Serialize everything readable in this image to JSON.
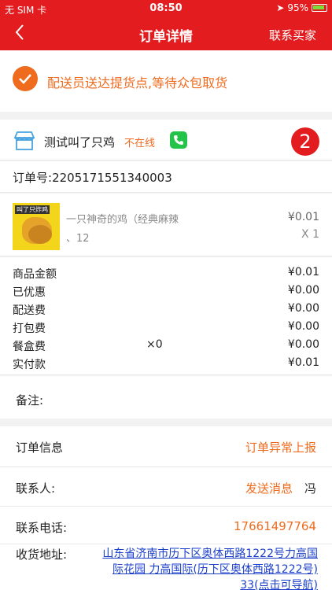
{
  "status_bar": {
    "carrier": "无 SIM 卡",
    "time": "08:50",
    "battery": "95%"
  },
  "nav": {
    "title": "订单详情",
    "contact": "联系买家"
  },
  "banner": {
    "message": "配送员送达提货点,等待众包取货",
    "accent": "#ef6b1e"
  },
  "store": {
    "name": "测试叫了只鸡",
    "status": "不在线",
    "badge": "2"
  },
  "order": {
    "label": "订单号:",
    "number": "2205171551340003"
  },
  "product": {
    "thumb_text": "叫了只炸鸡",
    "name_line1": "一只神奇的鸡（经典麻辣",
    "name_line2": "、12",
    "price": "¥0.01",
    "qty": "X 1"
  },
  "fees": [
    {
      "label": "商品金额",
      "mid": "",
      "value": "¥0.01"
    },
    {
      "label": "已优惠",
      "mid": "",
      "value": "¥0.00"
    },
    {
      "label": "配送费",
      "mid": "",
      "value": "¥0.00"
    },
    {
      "label": "打包费",
      "mid": "",
      "value": "¥0.00"
    },
    {
      "label": "餐盒费",
      "mid": "×0",
      "value": "¥0.00"
    },
    {
      "label": "实付款",
      "mid": "",
      "value": "¥0.01"
    }
  ],
  "remark": {
    "label": "备注:"
  },
  "info": {
    "order_info_label": "订单信息",
    "report": "订单异常上报",
    "contact_label": "联系人:",
    "send_message": "发送消息",
    "contact_name": "冯",
    "phone_label": "联系电话:",
    "phone": "17661497764",
    "address_label": "收货地址:",
    "address_line1": "山东省济南市历下区奥体西路1222号力高国",
    "address_line2": "际花园 力高国际(历下区奥体西路1222号)",
    "address_line3": "33(点击可导航)"
  },
  "colors": {
    "brand_red": "#e31c1f",
    "link_blue": "#1a3ec9",
    "phone_green": "#24c34a"
  }
}
